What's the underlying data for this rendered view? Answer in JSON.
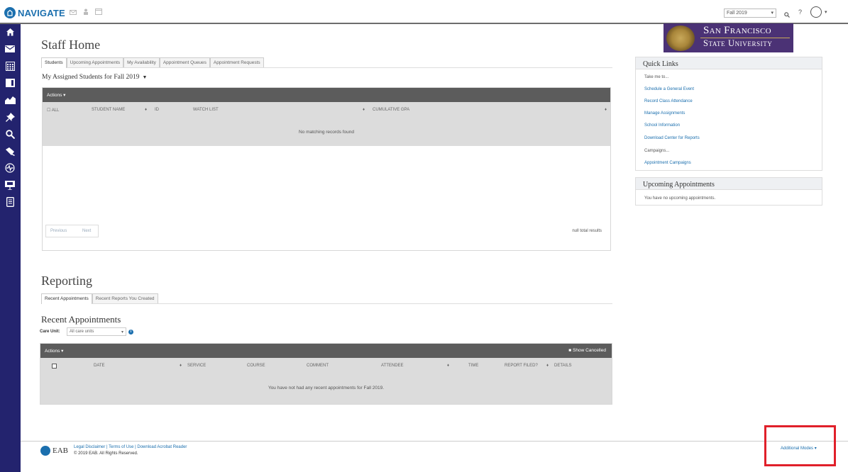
{
  "app": {
    "logo_text": "NAVIGATE",
    "term_selector": "Fall 2019",
    "help": "?"
  },
  "icons": {
    "top": [
      "mail-icon",
      "person-icon",
      "window-icon",
      "search-icon",
      "help-icon",
      "user-avatar-icon"
    ],
    "nav": [
      "home-icon",
      "mail-icon",
      "calendar-icon",
      "book-icon",
      "chart-icon",
      "pin-icon",
      "search-icon",
      "wand-icon",
      "pulse-icon",
      "presentation-icon",
      "document-icon"
    ]
  },
  "colors": {
    "nav_bg": "#23236e",
    "brand_blue": "#1b6fae",
    "sfsu_purple": "#4b3275",
    "highlight": "#e0202a",
    "table_header": "#5c5c5c"
  },
  "staff_home": {
    "title": "Staff Home",
    "tabs": [
      "Students",
      "Upcoming Appointments",
      "My Availability",
      "Appointment Queues",
      "Appointment Requests"
    ],
    "assigned_title": "My Assigned Students for Fall 2019",
    "actions_label": "Actions ▾",
    "columns": [
      "☐ ALL",
      "STUDENT NAME",
      "♦",
      "ID",
      "WATCH LIST",
      "♦",
      "CUMULATIVE GPA",
      "♦"
    ],
    "empty_message": "No matching records found",
    "pager_prev": "Previous",
    "pager_next": "Next",
    "total_results": "null total results"
  },
  "reporting": {
    "title": "Reporting",
    "tabs": [
      "Recent Appointments",
      "Recent Reports You Created"
    ],
    "recent_title": "Recent Appointments",
    "care_unit_label": "Care Unit:",
    "care_unit_value": "All care units",
    "info": "i",
    "actions_label": "Actions ▾",
    "show_cancelled": "■ Show Cancelled",
    "columns": [
      "DATE",
      "♦",
      "SERVICE",
      "COURSE",
      "COMMENT",
      "ATTENDEE",
      "♦",
      "TIME",
      "REPORT FILED?",
      "♦",
      "DETAILS"
    ],
    "empty_message": "You have not had any recent appointments for Fall 2019."
  },
  "sidebar": {
    "university_line1": "San Francisco",
    "university_line2": "State University",
    "quick_links_title": "Quick Links",
    "quick_links": [
      {
        "label": "Take me to...",
        "link": false
      },
      {
        "label": "Schedule a General Event",
        "link": true
      },
      {
        "label": "Record Class Attendance",
        "link": true
      },
      {
        "label": "Manage Assignments",
        "link": true
      },
      {
        "label": "School Information",
        "link": true
      },
      {
        "label": "Download Center for Reports",
        "link": true
      },
      {
        "label": "Campaigns...",
        "link": false
      },
      {
        "label": "Appointment Campaigns",
        "link": true
      }
    ],
    "upcoming_title": "Upcoming Appointments",
    "upcoming_empty": "You have no upcoming appointments."
  },
  "footer": {
    "eab_text": "EAB",
    "links": "Legal Disclaimer | Terms of Use | Download Acrobat Reader",
    "copyright": "© 2019 EAB. All Rights Reserved.",
    "additional_modes": "Additional Modes ▾"
  }
}
